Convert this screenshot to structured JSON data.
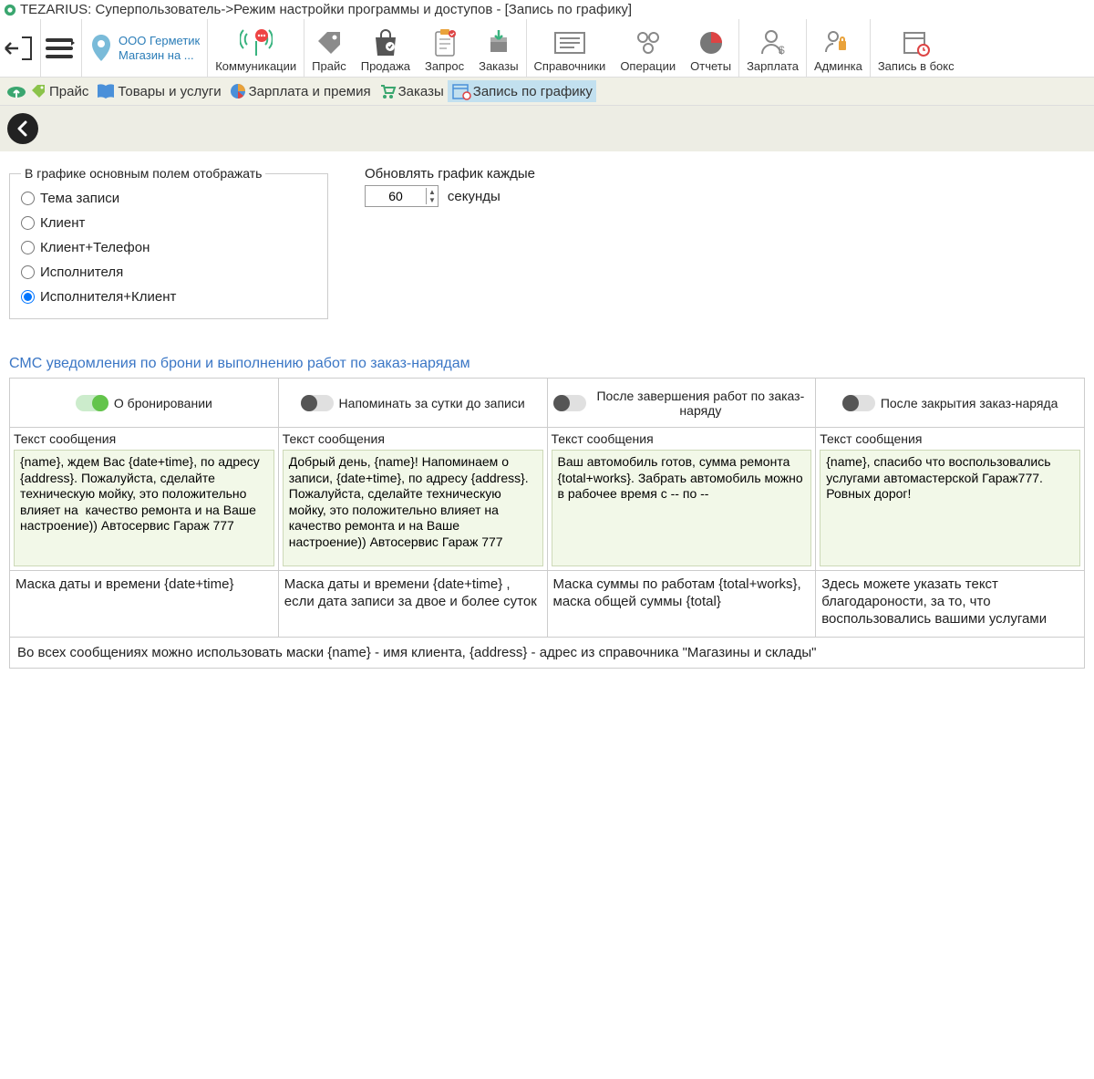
{
  "title": "TEZARIUS: Суперпользователь->Режим настройки программы и доступов - [Запись по графику]",
  "company": {
    "line1": "ООО Герметик",
    "line2": "Магазин на ..."
  },
  "toolbar": {
    "communication": "Коммуникации",
    "price": "Прайс",
    "sale": "Продажа",
    "request": "Запрос",
    "orders": "Заказы",
    "refs": "Справочники",
    "ops": "Операции",
    "reports": "Отчеты",
    "salary": "Зарплата",
    "admin": "Админка",
    "schedule": "Запись в бокс"
  },
  "subtabs": {
    "price": "Прайс",
    "goods": "Товары и услуги",
    "salary": "Зарплата и премия",
    "orders": "Заказы",
    "schedule": "Запись по графику"
  },
  "radio": {
    "legend": "В графике основным полем отображать",
    "opt1": "Тема записи",
    "opt2": "Клиент",
    "opt3": "Клиент+Телефон",
    "opt4": "Исполнителя",
    "opt5": "Исполнителя+Клиент"
  },
  "refresh": {
    "label": "Обновлять  график каждые",
    "value": "60",
    "unit": "секунды"
  },
  "sms": {
    "heading": "СМС уведомления по брони и выполнению работ по заказ-нарядам",
    "textLabel": "Текст сообщения",
    "col1": {
      "title": "О бронировании",
      "text": "{name}, ждем Вас {date+time}, по адресу {address}. Пожалуйста, сделайте техническую мойку, это положительно влияет на  качество ремонта и на Ваше настроение)) Автосервис Гараж 777",
      "hint": "Маска даты и времени {date+time}"
    },
    "col2": {
      "title": "Напоминать за сутки до записи",
      "text": "Добрый день, {name}! Напоминаем о записи, {date+time}, по адресу {address}. Пожалуйста, сделайте техническую мойку, это положительно влияет на  качество ремонта и на Ваше настроение)) Автосервис Гараж 777",
      "hint": "Маска даты и времени {date+time} , если дата записи за двое и более суток"
    },
    "col3": {
      "title": "После завершения работ по заказ-наряду",
      "text": "Ваш автомобиль готов, сумма ремонта {total+works}. Забрать автомобиль можно в рабочее время с -- по --",
      "hint": "Маска суммы по работам {total+works}, маска общей суммы {total}"
    },
    "col4": {
      "title": "После закрытия заказ-наряда",
      "text": "{name}, спасибо что воспользовались услугами автомастерской Гараж777. Ровных дорог!",
      "hint": "Здесь можете указать текст благодароности, за то, что воспользовались вашими услугами"
    },
    "footer": "Во всех сообщениях можно использовать маски {name} - имя клиента, {address} - адрес из справочника \"Магазины и склады\""
  }
}
